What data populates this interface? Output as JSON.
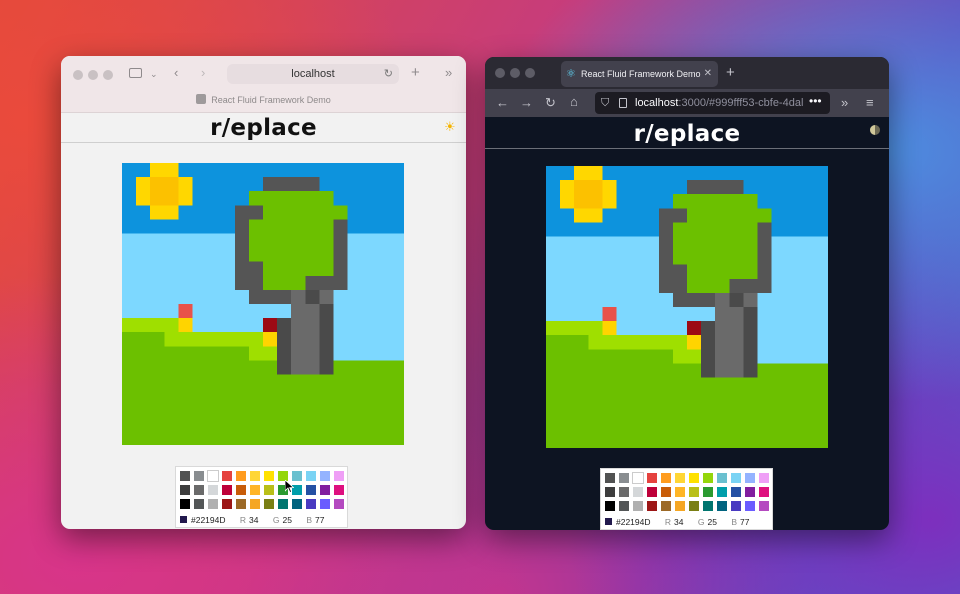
{
  "left_window": {
    "address": "localhost",
    "tab_title": "React Fluid Framework Demo",
    "icons": [
      "sidebar-icon",
      "chevron-down-icon",
      "back-arrow-icon",
      "forward-arrow-icon",
      "reload-icon",
      "new-tab-icon",
      "more-icon"
    ],
    "app_title": "r/eplace",
    "theme_toggle": "sun-icon"
  },
  "right_window": {
    "tab_title": "React Fluid Framework Demo",
    "address_host": "localhost",
    "address_path": ":3000/#999fff53-cbfe-4dal",
    "icons": [
      "react-icon",
      "close-icon",
      "new-tab-icon",
      "back-arrow-icon",
      "forward-arrow-icon",
      "reload-icon",
      "home-icon",
      "shield-icon",
      "page-icon",
      "overflow-icon",
      "more-icon",
      "menu-icon"
    ],
    "app_title": "r/eplace",
    "theme_toggle": "half-moon-icon"
  },
  "palette": {
    "colors": [
      [
        "#515252",
        "#898d90",
        "#ffffff",
        "#e5423f",
        "#ff9c1e",
        "#ffd635",
        "#ffe100",
        "#94d60a",
        "#6ac0cf",
        "#7ad3f4",
        "#94b3ff",
        "#ef9ff6"
      ],
      [
        "#3d3d3d",
        "#6a6a6a",
        "#d4d7d9",
        "#be0039",
        "#c85c08",
        "#ffb526",
        "#b9bf18",
        "#2a9a30",
        "#009eaa",
        "#2450a4",
        "#811e9f",
        "#de107f"
      ],
      [
        "#000000",
        "#535657",
        "#b0b0b0",
        "#9c1616",
        "#9c6926",
        "#f5a623",
        "#7a7f14",
        "#00756f",
        "#00637f",
        "#493ac1",
        "#6a5cff",
        "#b44ac0"
      ]
    ],
    "selected_hex": "#22194D",
    "r_label": "R",
    "r_value": "34",
    "g_label": "G",
    "g_value": "25",
    "b_label": "B",
    "b_value": "77"
  },
  "canvas_colors": {
    "sky_dark": "#0d93dd",
    "sky_light": "#7dd8ff",
    "sun": "#ffd700",
    "sun_core": "#fcc100",
    "tree_outline": "#555555",
    "tree_leaves": "#6cc000",
    "trunk": "#6a6a6a",
    "trunk_dark": "#4a4a4a",
    "grass": "#6cc000",
    "grass_light": "#9fdf00",
    "flower_red": "#e8524a",
    "flower_dark": "#9c0a14",
    "flower_yellow": "#ffd400"
  },
  "colors": {
    "left_bg": "#f2f2f2",
    "right_bg": "#0d1422",
    "left_title": "#111111",
    "right_title": "#ffffff"
  }
}
